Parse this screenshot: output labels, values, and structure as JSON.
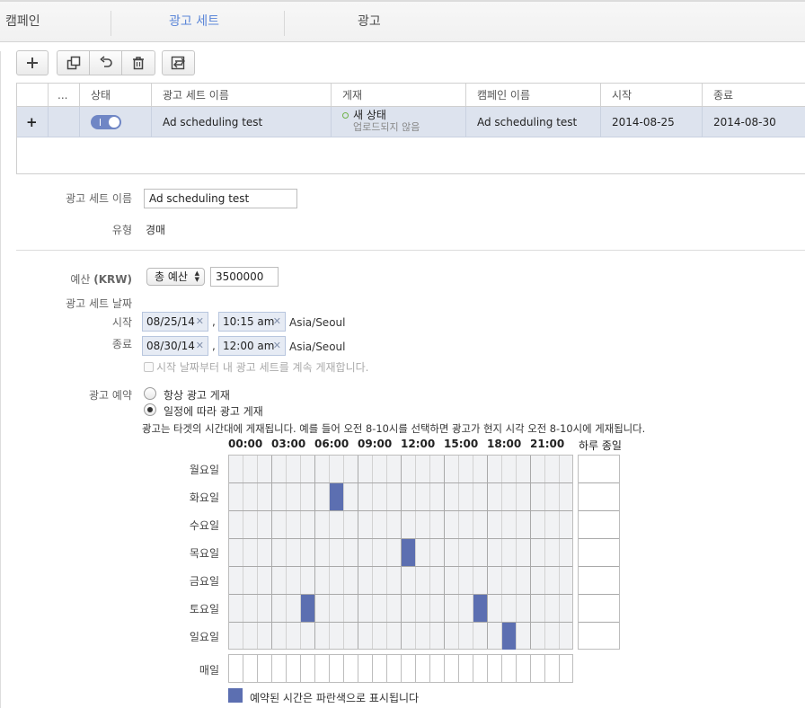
{
  "tabs": {
    "campaign": "캠페인",
    "adset": "광고 세트",
    "ad": "광고"
  },
  "colors": {
    "accent_tab": "#5b86d8",
    "schedule_block": "#5c6fb1",
    "row_selected": "#dde3ee",
    "status_green": "#6fb24a"
  },
  "toolbar": {
    "icons": [
      "plus-icon",
      "duplicate-icon",
      "undo-icon",
      "trash-icon",
      "export-icon"
    ]
  },
  "table": {
    "headers": {
      "more": "...",
      "status": "상태",
      "adset_name": "광고 세트 이름",
      "delivery": "게재",
      "campaign_name": "캠페인 이름",
      "start": "시작",
      "end": "종료"
    },
    "row": {
      "expand": "+",
      "adset_name": "Ad scheduling test",
      "delivery_status": "새 상태",
      "delivery_sub": "업로드되지 않음",
      "campaign_name": "Ad scheduling test",
      "start": "2014-08-25",
      "end": "2014-08-30"
    }
  },
  "form": {
    "adset_name_label": "광고 세트 이름",
    "adset_name_value": "Ad scheduling test",
    "type_label": "유형",
    "type_value": "경매",
    "budget_label": "예산",
    "budget_currency": "(KRW)",
    "budget_type": "총 예산",
    "budget_value": "3500000",
    "dates_label": "광고 세트 날짜",
    "start_label": "시작",
    "start_date": "08/25/14",
    "start_time": "10:15 am",
    "start_tz": "Asia/Seoul",
    "end_label": "종료",
    "end_date": "08/30/14",
    "end_time": "12:00 am",
    "end_tz": "Asia/Seoul",
    "comma": ",",
    "continuous_label": "시작 날짜부터 내 광고 세트를 계속 게재합니다.",
    "schedule_label": "광고 예약",
    "option_always": "항상 광고 게재",
    "option_scheduled": "일정에 따라 광고 게재",
    "schedule_note": "광고는 타겟의 시간대에 게재됩니다. 예를 들어 오전 8-10시를 선택하면 광고가 현지 시각 오전 8-10시에 게재됩니다."
  },
  "schedule": {
    "hour_labels": [
      "00:00",
      "03:00",
      "06:00",
      "09:00",
      "12:00",
      "15:00",
      "18:00",
      "21:00"
    ],
    "all_day_label": "하루 종일",
    "days": [
      "월요일",
      "화요일",
      "수요일",
      "목요일",
      "금요일",
      "토요일",
      "일요일"
    ],
    "daily_label": "매일",
    "legend": "예약된 시간은 파란색으로 표시됩니다",
    "blocks": [
      {
        "day": 1,
        "hour": 7
      },
      {
        "day": 3,
        "hour": 12
      },
      {
        "day": 5,
        "hour": 5
      },
      {
        "day": 5,
        "hour": 17
      },
      {
        "day": 6,
        "hour": 19
      }
    ]
  }
}
